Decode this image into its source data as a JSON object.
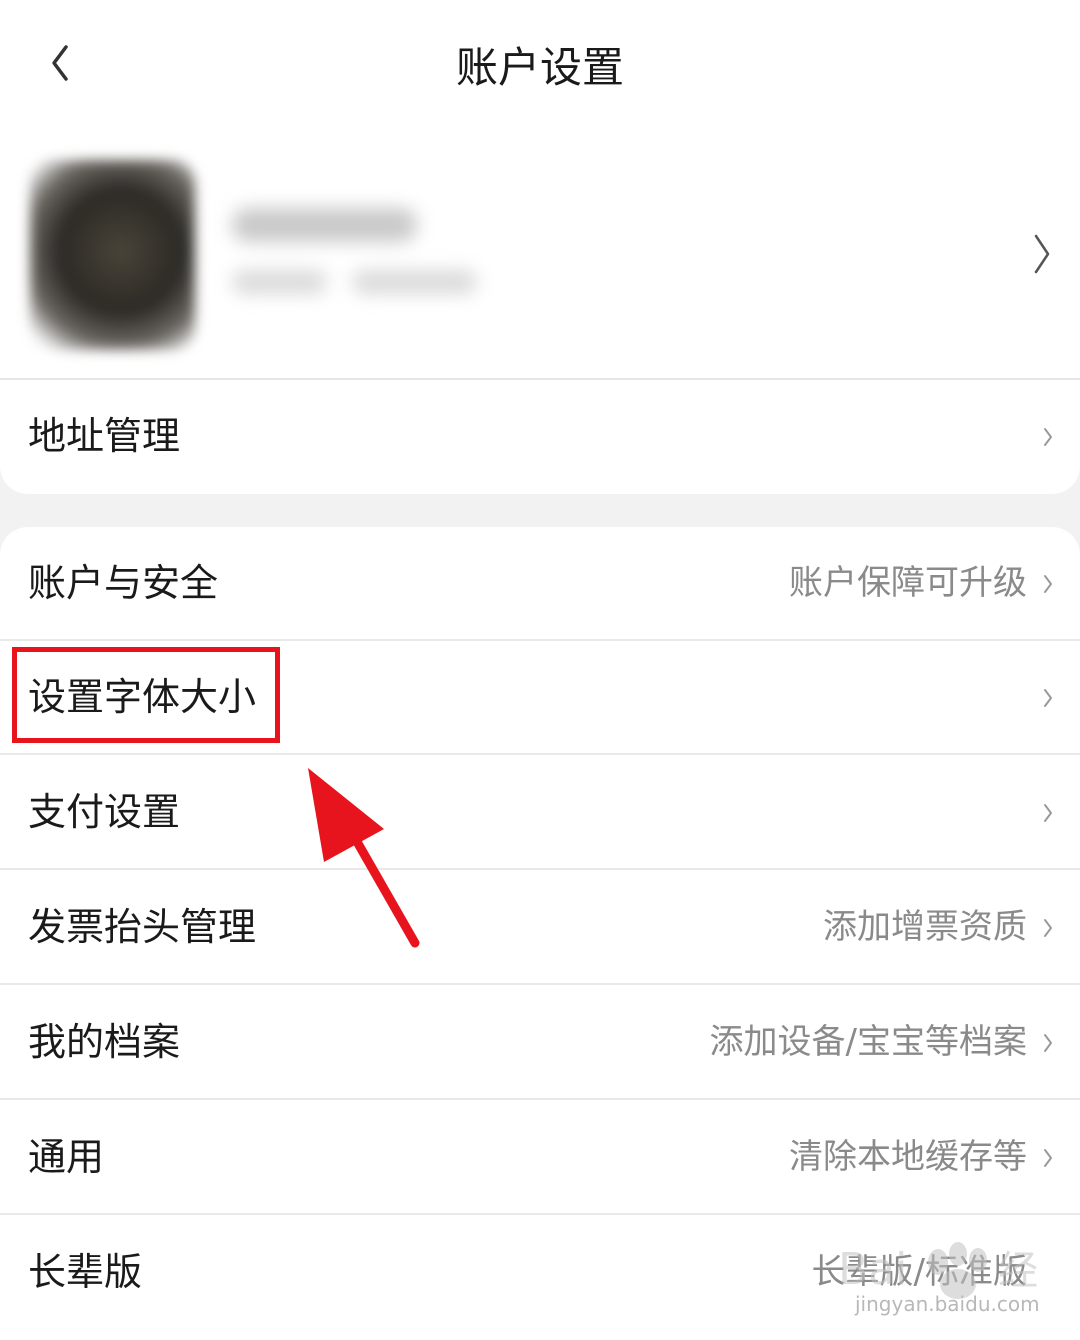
{
  "header": {
    "title": "账户设置"
  },
  "sections": [
    {
      "items": [
        {
          "label": "地址管理",
          "value": ""
        }
      ]
    },
    {
      "items": [
        {
          "label": "账户与安全",
          "value": "账户保障可升级"
        },
        {
          "label": "设置字体大小",
          "value": ""
        },
        {
          "label": "支付设置",
          "value": ""
        },
        {
          "label": "发票抬头管理",
          "value": "添加增票资质"
        },
        {
          "label": "我的档案",
          "value": "添加设备/宝宝等档案"
        },
        {
          "label": "通用",
          "value": "清除本地缓存等"
        },
        {
          "label": "长辈版",
          "value": "长辈版/标准版"
        }
      ]
    }
  ],
  "annotation": {
    "highlight_color": "#e8141d",
    "highlighted_item": "设置字体大小"
  },
  "watermark": {
    "text": "jingyan.baidu.com"
  }
}
